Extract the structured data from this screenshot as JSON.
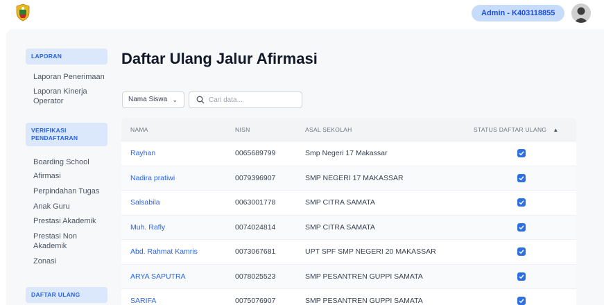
{
  "header": {
    "admin_label": "Admin - K403118855"
  },
  "sidebar": {
    "section_laporan": "LAPORAN",
    "laporan_items": [
      "Laporan Penerimaan",
      "Laporan Kinerja Operator"
    ],
    "section_verifikasi": "VERIFIKASI PENDAFTARAN",
    "verifikasi_items": [
      "Boarding School",
      "Afirmasi",
      "Perpindahan Tugas",
      "Anak Guru",
      "Prestasi Akademik",
      "Prestasi Non Akademik",
      "Zonasi"
    ],
    "section_daftar_ulang": "DAFTAR ULANG"
  },
  "main": {
    "title": "Daftar Ulang Jalur Afirmasi",
    "filter_selected": "Nama Siswa",
    "search_placeholder": "Cari data...",
    "columns": [
      "NAMA",
      "NISN",
      "ASAL SEKOLAH",
      "STATUS DAFTAR ULANG"
    ],
    "rows": [
      {
        "nama": "Rayhan",
        "nisn": "0065689799",
        "asal": "Smp Negeri 17 Makassar",
        "status": true
      },
      {
        "nama": "Nadira pratiwi",
        "nisn": "0079396907",
        "asal": "SMP NEGERI 17 MAKASSAR",
        "status": true
      },
      {
        "nama": "Salsabila",
        "nisn": "0063001778",
        "asal": "SMP CITRA SAMATA",
        "status": true
      },
      {
        "nama": "Muh. Rafly",
        "nisn": "0074024814",
        "asal": "SMP CITRA SAMATA",
        "status": true
      },
      {
        "nama": "Abd. Rahmat Kamris",
        "nisn": "0073067681",
        "asal": "UPT SPF SMP NEGERI 20 MAKASSAR",
        "status": true
      },
      {
        "nama": "ARYA SAPUTRA",
        "nisn": "0078025523",
        "asal": "SMP PESANTREN GUPPI SAMATA",
        "status": true
      },
      {
        "nama": "SARIFA",
        "nisn": "0075076907",
        "asal": "SMP PESANTREN GUPPI SAMATA",
        "status": true
      }
    ]
  },
  "colors": {
    "accent": "#2563eb",
    "badge_bg": "#c7dcfb",
    "sidebar_header_bg": "#dbe7fb",
    "content_bg": "#f7f8fa"
  }
}
